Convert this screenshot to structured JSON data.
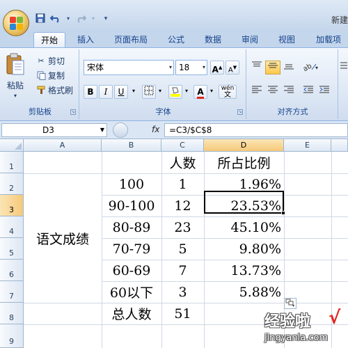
{
  "window": {
    "title": "新建"
  },
  "tabs": [
    "开始",
    "插入",
    "页面布局",
    "公式",
    "数据",
    "审阅",
    "视图",
    "加载项"
  ],
  "active_tab": "开始",
  "clipboard": {
    "paste_label": "粘贴",
    "cut_label": "剪切",
    "copy_label": "复制",
    "format_painter_label": "格式刷",
    "group_label": "剪贴板"
  },
  "font": {
    "family": "宋体",
    "size": "18",
    "grow": "A",
    "shrink": "A",
    "bold": "B",
    "italic": "I",
    "underline": "U",
    "font_color_glyph": "A",
    "phonetic": "wén",
    "group_label": "字体"
  },
  "alignment": {
    "group_label": "对齐方式"
  },
  "formula_bar": {
    "name_box": "D3",
    "fx": "fx",
    "formula": "=C3/$C$8"
  },
  "sheet": {
    "columns": [
      "A",
      "B",
      "C",
      "D",
      "E"
    ],
    "selected_column": "D",
    "rows": [
      "1",
      "2",
      "3",
      "4",
      "5",
      "6",
      "7",
      "8",
      "9"
    ],
    "selected_row": "3",
    "headers": {
      "count": "人数",
      "ratio": "所占比例"
    },
    "merged_label": "语文成绩",
    "data": [
      {
        "range": "100",
        "count": "1",
        "ratio": "1.96%"
      },
      {
        "range": "90-100",
        "count": "12",
        "ratio": "23.53%"
      },
      {
        "range": "80-89",
        "count": "23",
        "ratio": "45.10%"
      },
      {
        "range": "70-79",
        "count": "5",
        "ratio": "9.80%"
      },
      {
        "range": "60-69",
        "count": "7",
        "ratio": "13.73%"
      },
      {
        "range": "60以下",
        "count": "3",
        "ratio": "5.88%"
      }
    ],
    "total": {
      "label": "总人数",
      "count": "51"
    }
  },
  "watermark": {
    "title": "经验啦",
    "check": "√",
    "url": "jingyanla.com"
  },
  "colors": {
    "ribbon": "#dbe6f4",
    "selection_header": "#f6c979",
    "grid": "#d0d7e5"
  }
}
